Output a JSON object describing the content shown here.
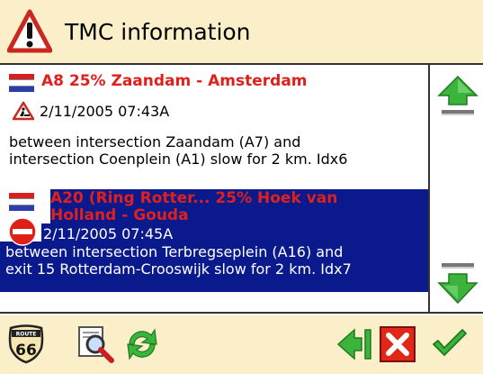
{
  "header": {
    "title": "TMC information",
    "icon": "warning-icon"
  },
  "messages": [
    {
      "road": "A8 25% Zaandam - Amsterdam",
      "timestamp": "2/11/2005 07:43A",
      "description_lines": [
        "between intersection Zaandam (A7) and",
        "intersection Coenplein (A1) slow for 2 km. Idx6"
      ],
      "flag": "netherlands-flag-icon",
      "event_icon": "roadworks-icon",
      "selected": false
    },
    {
      "road_lines": [
        "A20 (Ring Rotter... 25% Hoek van",
        "Holland - Gouda"
      ],
      "timestamp": "2/11/2005 07:45A",
      "description_lines": [
        "between intersection Terbregseplein (A16) and",
        "exit 15 Rotterdam-Crooswijk slow for 2 km. Idx7"
      ],
      "flag": "netherlands-flag-icon",
      "event_icon": "no-entry-icon",
      "selected": true
    }
  ],
  "scrollbar": {
    "up": "scroll-up-arrow-icon",
    "down": "scroll-down-arrow-icon"
  },
  "footer": {
    "buttons": [
      "route-66-icon",
      "zoom-map-icon",
      "refresh-icon",
      "back-icon",
      "cancel-icon",
      "ok-check-icon"
    ],
    "route66_text_top": "ROUTE",
    "route66_text_num": "66"
  },
  "colors": {
    "header_bg": "#fbefc9",
    "selection_bg": "#0a1a8c",
    "road_text": "#e0201c",
    "arrow_green": "#3cb43c"
  }
}
